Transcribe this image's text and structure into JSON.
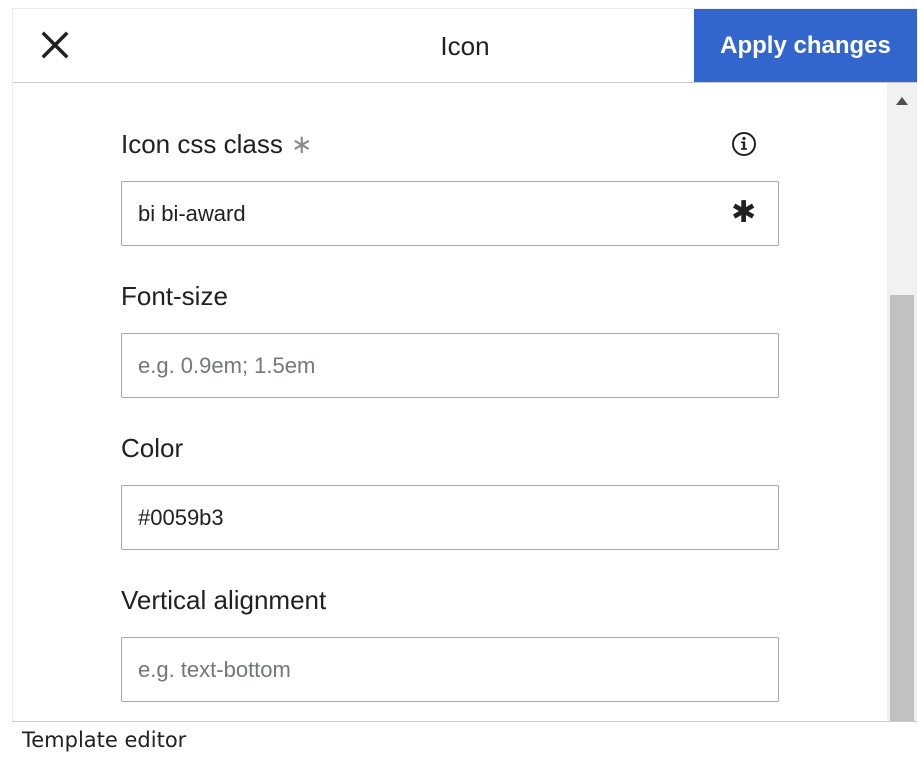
{
  "dialog": {
    "title": "Icon",
    "apply_label": "Apply changes",
    "close_icon": "close-icon"
  },
  "fields": {
    "icon_css_class": {
      "label": "Icon css class",
      "required_mark": "∗",
      "value": "bi bi-award",
      "suffix": "✱"
    },
    "font_size": {
      "label": "Font-size",
      "value": "",
      "placeholder": "e.g. 0.9em; 1.5em"
    },
    "color": {
      "label": "Color",
      "value": "#0059b3"
    },
    "vertical_alignment": {
      "label": "Vertical alignment",
      "value": "",
      "placeholder": "e.g. text-bottom"
    }
  },
  "footer": {
    "label": "Template editor"
  },
  "colors": {
    "accent": "#3366cc",
    "text": "#202122",
    "border": "#a2a9b1"
  }
}
